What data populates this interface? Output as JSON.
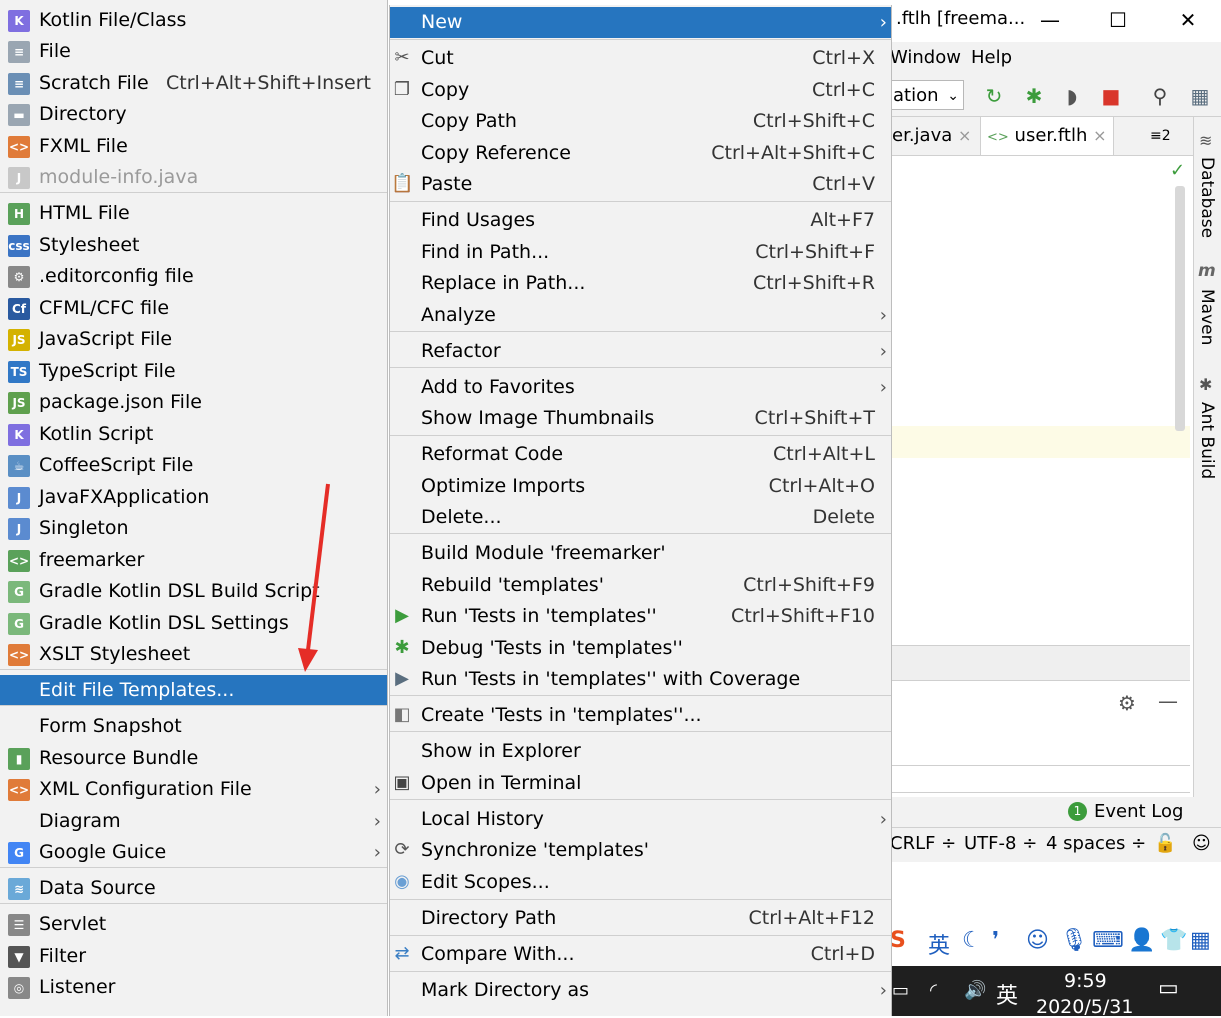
{
  "ide": {
    "window_title": ".ftlh [freema...",
    "menu_window": "Window",
    "menu_help": "Help",
    "run_config": "ation",
    "tabs": [
      {
        "label": "er.java",
        "close": "×"
      },
      {
        "label": "user.ftlh",
        "close": "×"
      }
    ],
    "tab_overflow": "≡2",
    "side_labels": {
      "database": "Database",
      "maven": "Maven",
      "ant": "Ant Build"
    },
    "event_log": "Event Log",
    "event_log_count": "1",
    "status": {
      "line_sep": "CRLF ÷",
      "encoding": "UTF-8 ÷",
      "indent": "4 spaces ÷"
    },
    "ime": {
      "lang": "英"
    },
    "taskbar": {
      "lang": "英",
      "time": "9:59",
      "date": "2020/5/31"
    }
  },
  "submenu": {
    "items": [
      {
        "label": "Kotlin File/Class",
        "icon": "kotlin-file-icon",
        "color": "#7f6fe0",
        "glyph": "K"
      },
      {
        "label": "File",
        "icon": "file-icon",
        "color": "#9aa6b2",
        "glyph": "≡"
      },
      {
        "label": "Scratch File",
        "shortcut": "Ctrl+Alt+Shift+Insert",
        "icon": "scratch-file-icon",
        "color": "#6b8fb5",
        "glyph": "≡"
      },
      {
        "label": "Directory",
        "icon": "folder-icon",
        "color": "#9aa6b2",
        "glyph": "▬"
      },
      {
        "label": "FXML File",
        "icon": "fxml-file-icon",
        "color": "#e07b39",
        "glyph": "<>"
      },
      {
        "label": "module-info.java",
        "icon": "java-file-icon",
        "color": "#c8c8c8",
        "glyph": "J",
        "disabled": true
      },
      {
        "label": "HTML File",
        "icon": "html-file-icon",
        "color": "#5aa15a",
        "glyph": "H"
      },
      {
        "label": "Stylesheet",
        "icon": "css-file-icon",
        "color": "#3b74c4",
        "glyph": "css"
      },
      {
        "label": ".editorconfig file",
        "icon": "editorconfig-icon",
        "color": "#888888",
        "glyph": "⚙"
      },
      {
        "label": "CFML/CFC file",
        "icon": "cfml-file-icon",
        "color": "#2a5aa0",
        "glyph": "Cf"
      },
      {
        "label": "JavaScript File",
        "icon": "javascript-file-icon",
        "color": "#d4b200",
        "glyph": "JS"
      },
      {
        "label": "TypeScript File",
        "icon": "typescript-file-icon",
        "color": "#3178c6",
        "glyph": "TS"
      },
      {
        "label": "package.json File",
        "icon": "nodejs-icon",
        "color": "#5fa04e",
        "glyph": "JS"
      },
      {
        "label": "Kotlin Script",
        "icon": "kotlin-script-icon",
        "color": "#7f6fe0",
        "glyph": "K"
      },
      {
        "label": "CoffeeScript File",
        "icon": "coffeescript-file-icon",
        "color": "#5a8fc4",
        "glyph": "☕"
      },
      {
        "label": "JavaFXApplication",
        "icon": "javafx-file-icon",
        "color": "#5b8bd0",
        "glyph": "J"
      },
      {
        "label": "Singleton",
        "icon": "singleton-file-icon",
        "color": "#5b8bd0",
        "glyph": "J"
      },
      {
        "label": "freemarker",
        "icon": "freemarker-file-icon",
        "color": "#5aa15a",
        "glyph": "<>"
      },
      {
        "label": "Gradle Kotlin DSL Build Script",
        "icon": "gradle-icon",
        "color": "#7bb87b",
        "glyph": "G"
      },
      {
        "label": "Gradle Kotlin DSL Settings",
        "icon": "gradle-icon",
        "color": "#7bb87b",
        "glyph": "G"
      },
      {
        "label": "XSLT Stylesheet",
        "icon": "xslt-file-icon",
        "color": "#e07b39",
        "glyph": "<>"
      },
      {
        "label": "Edit File Templates...",
        "selected": true
      },
      {
        "label": "Form Snapshot"
      },
      {
        "label": "Resource Bundle",
        "icon": "resource-bundle-icon",
        "color": "#5aa15a",
        "glyph": "▮"
      },
      {
        "label": "XML Configuration File",
        "icon": "xml-file-icon",
        "color": "#e07b39",
        "glyph": "<>",
        "submenu": true
      },
      {
        "label": "Diagram",
        "submenu": true
      },
      {
        "label": "Google Guice",
        "icon": "google-icon",
        "color": "#4285f4",
        "glyph": "G",
        "submenu": true
      },
      {
        "label": "Data Source",
        "icon": "database-icon",
        "color": "#6aa9d8",
        "glyph": "≋"
      },
      {
        "label": "Servlet",
        "icon": "servlet-icon",
        "color": "#888888",
        "glyph": "☰"
      },
      {
        "label": "Filter",
        "icon": "filter-icon",
        "color": "#555555",
        "glyph": "▼"
      },
      {
        "label": "Listener",
        "icon": "listener-icon",
        "color": "#888888",
        "glyph": "◎"
      }
    ]
  },
  "ctxmenu": {
    "items": [
      {
        "label": "New",
        "selected": true,
        "submenu": true
      },
      {
        "label": "Cut",
        "shortcut": "Ctrl+X",
        "icon": "scissors-icon",
        "glyph": "✂"
      },
      {
        "label": "Copy",
        "shortcut": "Ctrl+C",
        "icon": "copy-icon",
        "glyph": "❐"
      },
      {
        "label": "Copy Path",
        "shortcut": "Ctrl+Shift+C"
      },
      {
        "label": "Copy Reference",
        "shortcut": "Ctrl+Alt+Shift+C"
      },
      {
        "label": "Paste",
        "shortcut": "Ctrl+V",
        "icon": "paste-icon",
        "glyph": "📋"
      },
      {
        "label": "Find Usages",
        "shortcut": "Alt+F7"
      },
      {
        "label": "Find in Path...",
        "shortcut": "Ctrl+Shift+F"
      },
      {
        "label": "Replace in Path...",
        "shortcut": "Ctrl+Shift+R"
      },
      {
        "label": "Analyze",
        "submenu": true
      },
      {
        "label": "Refactor",
        "submenu": true
      },
      {
        "label": "Add to Favorites",
        "submenu": true
      },
      {
        "label": "Show Image Thumbnails",
        "shortcut": "Ctrl+Shift+T"
      },
      {
        "label": "Reformat Code",
        "shortcut": "Ctrl+Alt+L"
      },
      {
        "label": "Optimize Imports",
        "shortcut": "Ctrl+Alt+O"
      },
      {
        "label": "Delete...",
        "shortcut": "Delete"
      },
      {
        "label": "Build Module 'freemarker'"
      },
      {
        "label": "Rebuild 'templates'",
        "shortcut": "Ctrl+Shift+F9"
      },
      {
        "label": "Run 'Tests in 'templates''",
        "shortcut": "Ctrl+Shift+F10",
        "icon": "run-icon",
        "glyph": "▶",
        "color": "#3c9c3c"
      },
      {
        "label": "Debug 'Tests in 'templates''",
        "icon": "debug-icon",
        "glyph": "✱",
        "color": "#3c9c3c"
      },
      {
        "label": "Run 'Tests in 'templates'' with Coverage",
        "icon": "coverage-icon",
        "glyph": "▶",
        "color": "#5a6e7f"
      },
      {
        "label": "Create 'Tests in 'templates''...",
        "icon": "create-config-icon",
        "glyph": "◧",
        "color": "#777777"
      },
      {
        "label": "Show in Explorer"
      },
      {
        "label": "Open in Terminal",
        "icon": "terminal-icon",
        "glyph": "▣",
        "color": "#444444"
      },
      {
        "label": "Local History",
        "submenu": true
      },
      {
        "label": "Synchronize 'templates'",
        "icon": "sync-icon",
        "glyph": "⟳",
        "color": "#555555"
      },
      {
        "label": "Edit Scopes...",
        "icon": "scopes-icon",
        "glyph": "◉",
        "color": "#6a9fd4"
      },
      {
        "label": "Directory Path",
        "shortcut": "Ctrl+Alt+F12"
      },
      {
        "label": "Compare With...",
        "shortcut": "Ctrl+D",
        "icon": "compare-icon",
        "glyph": "⇄",
        "color": "#3b7fc4"
      },
      {
        "label": "Mark Directory as",
        "submenu": true
      }
    ]
  }
}
